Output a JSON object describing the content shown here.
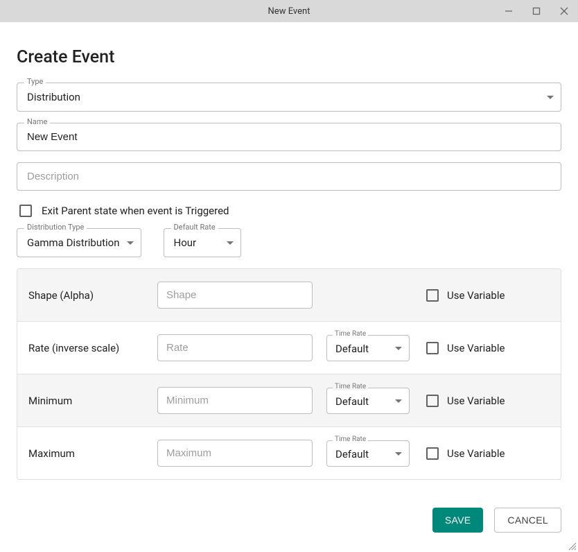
{
  "window": {
    "title": "New Event"
  },
  "heading": "Create Event",
  "fields": {
    "type": {
      "label": "Type",
      "value": "Distribution"
    },
    "name": {
      "label": "Name",
      "value": "New Event"
    },
    "desc": {
      "placeholder": "Description",
      "value": ""
    }
  },
  "exit_parent": {
    "label": "Exit Parent state when event is Triggered",
    "checked": false
  },
  "dist_type": {
    "label": "Distribution Type",
    "value": "Gamma Distribution"
  },
  "default_rate": {
    "label": "Default Rate",
    "value": "Hour"
  },
  "params": [
    {
      "label": "Shape (Alpha)",
      "placeholder": "Shape",
      "has_rate": false,
      "rate_label": "",
      "rate_value": "",
      "usevar_label": "Use Variable",
      "usevar_checked": false,
      "alt": true
    },
    {
      "label": "Rate (inverse scale)",
      "placeholder": "Rate",
      "has_rate": true,
      "rate_label": "Time Rate",
      "rate_value": "Default",
      "usevar_label": "Use Variable",
      "usevar_checked": false,
      "alt": false
    },
    {
      "label": "Minimum",
      "placeholder": "Minimum",
      "has_rate": true,
      "rate_label": "Time Rate",
      "rate_value": "Default",
      "usevar_label": "Use Variable",
      "usevar_checked": false,
      "alt": true
    },
    {
      "label": "Maximum",
      "placeholder": "Maximum",
      "has_rate": true,
      "rate_label": "Time Rate",
      "rate_value": "Default",
      "usevar_label": "Use Variable",
      "usevar_checked": false,
      "alt": false
    }
  ],
  "actions": {
    "save": "SAVE",
    "cancel": "CANCEL"
  }
}
